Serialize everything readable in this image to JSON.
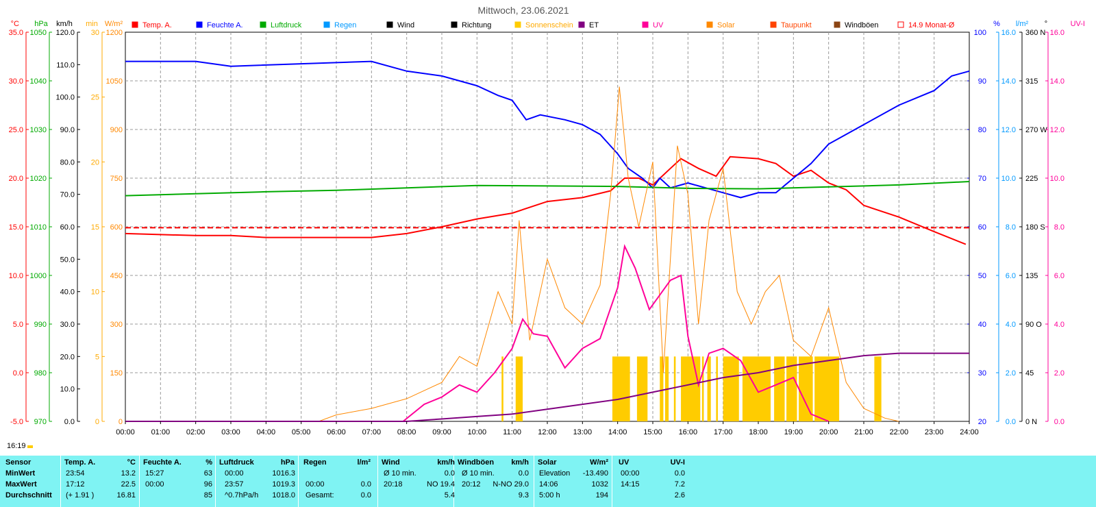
{
  "title": "Mittwoch, 23.06.2021",
  "clock": "16:19",
  "legend": [
    {
      "label": "Temp. A.",
      "color": "#ff0000"
    },
    {
      "label": "Feuchte A.",
      "color": "#0000ff"
    },
    {
      "label": "Luftdruck",
      "color": "#00aa00"
    },
    {
      "label": "Regen",
      "color": "#0099ff"
    },
    {
      "label": "Wind",
      "color": "#000000"
    },
    {
      "label": "Richtung",
      "color": "#000000"
    },
    {
      "label": "Sonnenschein",
      "color": "#ffcc00"
    },
    {
      "label": "ET",
      "color": "#800080"
    },
    {
      "label": "UV",
      "color": "#ff0099"
    },
    {
      "label": "Solar",
      "color": "#ff8800"
    },
    {
      "label": "Taupunkt",
      "color": "#ff4400"
    },
    {
      "label": "Windböen",
      "color": "#8b4513"
    },
    {
      "label": "14.9 Monat-Ø",
      "color": "#ff0000"
    }
  ],
  "axes": {
    "temp_unit": "°C",
    "hpa_unit": "hPa",
    "kmh_unit": "km/h",
    "min_unit": "min",
    "wm2_unit": "W/m²",
    "pct_unit": "%",
    "lm2_unit": "l/m²",
    "deg_unit": "°",
    "uvi_unit": "UV-I",
    "temp_ticks": [
      "35.0",
      "30.0",
      "25.0",
      "20.0",
      "15.0",
      "10.0",
      "5.0",
      "0.0",
      "-5.0"
    ],
    "hpa_ticks": [
      "1050",
      "1040",
      "1030",
      "1020",
      "1010",
      "1000",
      "990",
      "980",
      "970"
    ],
    "kmh_ticks": [
      "120.0",
      "110.0",
      "100.0",
      "90.0",
      "80.0",
      "70.0",
      "60.0",
      "50.0",
      "40.0",
      "30.0",
      "20.0",
      "10.0",
      "0.0"
    ],
    "min_ticks": [
      "30",
      "25",
      "20",
      "15",
      "10",
      "5",
      "0"
    ],
    "wm2_ticks": [
      "1200",
      "1050",
      "900",
      "750",
      "600",
      "450",
      "300",
      "150",
      "0"
    ],
    "pct_ticks": [
      "100",
      "90",
      "80",
      "70",
      "60",
      "50",
      "40",
      "30",
      "20"
    ],
    "lm2_ticks": [
      "16.0",
      "14.0",
      "12.0",
      "10.0",
      "8.0",
      "6.0",
      "4.0",
      "2.0",
      "0.0"
    ],
    "deg_ticks": [
      "360 N",
      "315",
      "270 W",
      "225",
      "180 S",
      "135",
      "90 O",
      "45",
      "0 N"
    ],
    "uvi_ticks": [
      "16.0",
      "14.0",
      "12.0",
      "10.0",
      "8.0",
      "6.0",
      "4.0",
      "2.0",
      "0.0"
    ],
    "time_ticks": [
      "00:00",
      "01:00",
      "02:00",
      "03:00",
      "04:00",
      "05:00",
      "06:00",
      "07:00",
      "08:00",
      "09:00",
      "10:00",
      "11:00",
      "12:00",
      "13:00",
      "14:00",
      "15:00",
      "16:00",
      "17:00",
      "18:00",
      "19:00",
      "20:00",
      "21:00",
      "22:00",
      "23:00",
      "24:00"
    ]
  },
  "chart_data": {
    "type": "line",
    "title": "Mittwoch, 23.06.2021",
    "x_hours": [
      0,
      1,
      2,
      3,
      4,
      5,
      6,
      7,
      8,
      9,
      10,
      11,
      12,
      13,
      14,
      15,
      16,
      17,
      18,
      19,
      20,
      21,
      22,
      23,
      24
    ],
    "series": [
      {
        "name": "Temp. A.",
        "unit": "°C",
        "color": "#ff0000",
        "x": [
          0,
          1,
          2,
          3,
          4,
          5,
          6,
          7,
          8,
          9,
          10,
          11,
          12,
          13,
          13.8,
          14.2,
          14.6,
          15,
          15.5,
          15.8,
          16.3,
          16.8,
          17.2,
          18,
          18.5,
          19,
          19.5,
          20,
          20.5,
          21,
          22,
          23,
          23.9
        ],
        "y": [
          14.3,
          14.2,
          14.1,
          14.1,
          13.9,
          13.9,
          13.9,
          13.9,
          14.3,
          15.0,
          15.8,
          16.4,
          17.6,
          18.0,
          18.7,
          20.0,
          20.0,
          19.3,
          21.0,
          22.0,
          21.0,
          20.2,
          22.2,
          22.0,
          21.5,
          20.2,
          20.8,
          19.5,
          18.8,
          17.2,
          16.0,
          14.5,
          13.2
        ]
      },
      {
        "name": "Feuchte A.",
        "unit": "%",
        "color": "#0000ff",
        "x": [
          0,
          2,
          3,
          7,
          8,
          9,
          10,
          10.6,
          11,
          11.4,
          11.8,
          12.5,
          13,
          13.5,
          14,
          14.3,
          14.7,
          15,
          15.2,
          15.5,
          16,
          16.5,
          17,
          17.5,
          18,
          18.5,
          19,
          19.5,
          20,
          20.5,
          21,
          22,
          23,
          23.5,
          24
        ],
        "y": [
          94,
          94,
          93,
          94,
          92,
          91,
          89,
          87,
          86,
          82,
          83,
          82,
          81,
          79,
          75,
          72,
          70,
          68,
          70,
          68,
          69,
          68,
          67,
          66,
          67,
          67,
          70,
          73,
          77,
          79,
          81,
          85,
          88,
          91,
          92
        ]
      },
      {
        "name": "Luftdruck",
        "unit": "hPa",
        "color": "#00aa00",
        "x": [
          0,
          2,
          4,
          6,
          8,
          10,
          12,
          14,
          16,
          18,
          20,
          22,
          24
        ],
        "y": [
          1016.4,
          1016.8,
          1017.2,
          1017.5,
          1018.0,
          1018.5,
          1018.4,
          1018.3,
          1017.9,
          1017.8,
          1018.2,
          1018.6,
          1019.3
        ]
      },
      {
        "name": "Solar",
        "unit": "W/m²",
        "color": "#ff8800",
        "x": [
          0,
          5.5,
          6,
          7,
          8,
          9,
          9.5,
          10,
          10.6,
          11,
          11.2,
          11.5,
          12,
          12.5,
          13,
          13.5,
          13.8,
          14.05,
          14.3,
          14.6,
          15,
          15.3,
          15.7,
          16,
          16.3,
          16.6,
          17,
          17.4,
          17.8,
          18.2,
          18.6,
          19,
          19.5,
          20,
          20.5,
          21,
          21.6,
          22
        ],
        "y": [
          0,
          0,
          20,
          40,
          70,
          120,
          200,
          170,
          400,
          300,
          620,
          250,
          500,
          350,
          300,
          420,
          700,
          1032,
          750,
          600,
          800,
          150,
          850,
          700,
          300,
          620,
          780,
          400,
          300,
          400,
          450,
          250,
          200,
          350,
          120,
          40,
          10,
          0
        ]
      },
      {
        "name": "UV",
        "unit": "UV-I",
        "color": "#ff0099",
        "x": [
          0,
          7.9,
          8.5,
          9,
          9.5,
          10,
          10.5,
          11,
          11.3,
          11.6,
          12,
          12.5,
          13,
          13.5,
          14,
          14.2,
          14.5,
          14.9,
          15.2,
          15.5,
          15.8,
          16,
          16.3,
          16.6,
          17,
          17.5,
          18,
          18.5,
          19,
          19.5,
          20
        ],
        "y": [
          0,
          0,
          0.7,
          1.0,
          1.5,
          1.2,
          2.0,
          3.0,
          4.2,
          3.6,
          3.5,
          2.2,
          3.0,
          3.4,
          5.5,
          7.2,
          6.3,
          4.6,
          5.2,
          5.8,
          6.0,
          3.5,
          1.5,
          2.8,
          3.0,
          2.5,
          1.2,
          1.5,
          1.8,
          0.3,
          0
        ]
      },
      {
        "name": "ET",
        "unit": "l/m²",
        "color": "#800080",
        "x": [
          0,
          8,
          9,
          10,
          11,
          12,
          13,
          14,
          15,
          16,
          17,
          18,
          19,
          20,
          21,
          22,
          24
        ],
        "y": [
          0,
          0,
          0.1,
          0.2,
          0.3,
          0.5,
          0.7,
          0.9,
          1.2,
          1.5,
          1.8,
          2.0,
          2.3,
          2.5,
          2.7,
          2.8,
          2.8
        ]
      },
      {
        "name": "14.9 Monat-Ø",
        "unit": "°C",
        "color": "#ff0000",
        "x": [
          0,
          24
        ],
        "y": [
          14.9,
          14.9
        ]
      },
      {
        "name": "Sonnenschein",
        "unit": "min",
        "color": "#ffcc00",
        "bars": [
          [
            10.7,
            10.75
          ],
          [
            11.1,
            11.3
          ],
          [
            13.85,
            14.35
          ],
          [
            14.55,
            14.85
          ],
          [
            15.2,
            15.3
          ],
          [
            15.35,
            15.45
          ],
          [
            15.6,
            15.65
          ],
          [
            15.8,
            16.35
          ],
          [
            16.4,
            16.45
          ],
          [
            16.55,
            16.65
          ],
          [
            16.8,
            16.85
          ],
          [
            17.0,
            17.45
          ],
          [
            17.55,
            18.35
          ],
          [
            18.45,
            18.75
          ],
          [
            18.8,
            19.1
          ],
          [
            19.15,
            19.55
          ],
          [
            19.6,
            20.3
          ],
          [
            21.3,
            21.5
          ]
        ],
        "level": 5
      }
    ]
  },
  "stats": {
    "headers": [
      "Sensor",
      "Temp. A.",
      "°C",
      "Feuchte A.",
      "%",
      "Luftdruck",
      "hPa",
      "Regen",
      "l/m²",
      "Wind",
      "km/h",
      "Windböen",
      "km/h",
      "Solar",
      "W/m²",
      "UV",
      "UV-I"
    ],
    "rows": [
      {
        "label": "MinWert",
        "t_time": "23:54",
        "t_val": "13.2",
        "f_time": "15:27",
        "f_val": "63",
        "p_time": "00:00",
        "p_val": "1016.3",
        "r_time": "",
        "r_val": "",
        "w_label": "Ø 10 min.",
        "w_val": "0.0",
        "g_label": "Ø 10 min.",
        "g_val": "0.0",
        "s_label": "Elevation",
        "s_val": "-13.490",
        "u_time": "00:00",
        "u_val": "0.0"
      },
      {
        "label": "MaxWert",
        "t_time": "17:12",
        "t_val": "22.5",
        "f_time": "00:00",
        "f_val": "96",
        "p_time": "23:57",
        "p_val": "1019.3",
        "r_time": "00:00",
        "r_val": "0.0",
        "w_label": "20:18",
        "w_val": "NO 19.4",
        "g_label": "20:12",
        "g_val": "N-NO 29.0",
        "s_label": "14:06",
        "s_val": "1032",
        "u_time": "14:15",
        "u_val": "7.2"
      },
      {
        "label": "Durchschnitt",
        "t_time": "(+ 1.91 )",
        "t_val": "16.81",
        "f_time": "",
        "f_val": "85",
        "p_time": "^0.7hPa/h",
        "p_val": "1018.0",
        "r_time": "Gesamt:",
        "r_val": "0.0",
        "w_label": "",
        "w_val": "5.4",
        "g_label": "",
        "g_val": "9.3",
        "s_label": "5:00 h",
        "s_val": "194",
        "u_time": "",
        "u_val": "2.6"
      }
    ]
  }
}
